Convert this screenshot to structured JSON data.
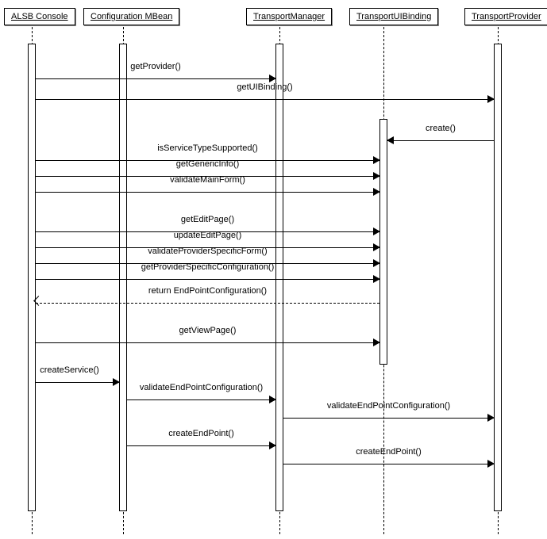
{
  "participants": {
    "p1": "ALSB Console",
    "p2": "Configuration MBean",
    "p3": "TransportManager",
    "p4": "TransportUIBinding",
    "p5": "TransportProvider"
  },
  "messages": {
    "m1": "getProvider()",
    "m2": "getUIBinding()",
    "m3": "create()",
    "m4": "isServiceTypeSupported()",
    "m5": "getGenericInfo()",
    "m6": "validateMainForm()",
    "m7": "getEditPage()",
    "m8": "updateEditPage()",
    "m9": "validateProviderSpecificForm()",
    "m10": "getProviderSpecificConfiguration()",
    "m11": "return EndPointConfiguration()",
    "m12": "getViewPage()",
    "m13": "createService()",
    "m14": "validateEndPointConfiguration()",
    "m15": "validateEndPointConfiguration()",
    "m16": "createEndPoint()",
    "m17": "createEndPoint()"
  },
  "layout": {
    "x": {
      "p1": 40,
      "p2": 155,
      "p3": 352,
      "p4": 483,
      "p5": 627
    },
    "boxLeft": {
      "p1": 5,
      "p2": 105,
      "p3": 310,
      "p4": 440,
      "p5": 585
    },
    "boxWidth": {
      "p1": 78,
      "p2": 108,
      "p3": 92,
      "p4": 98,
      "p5": 92
    }
  }
}
